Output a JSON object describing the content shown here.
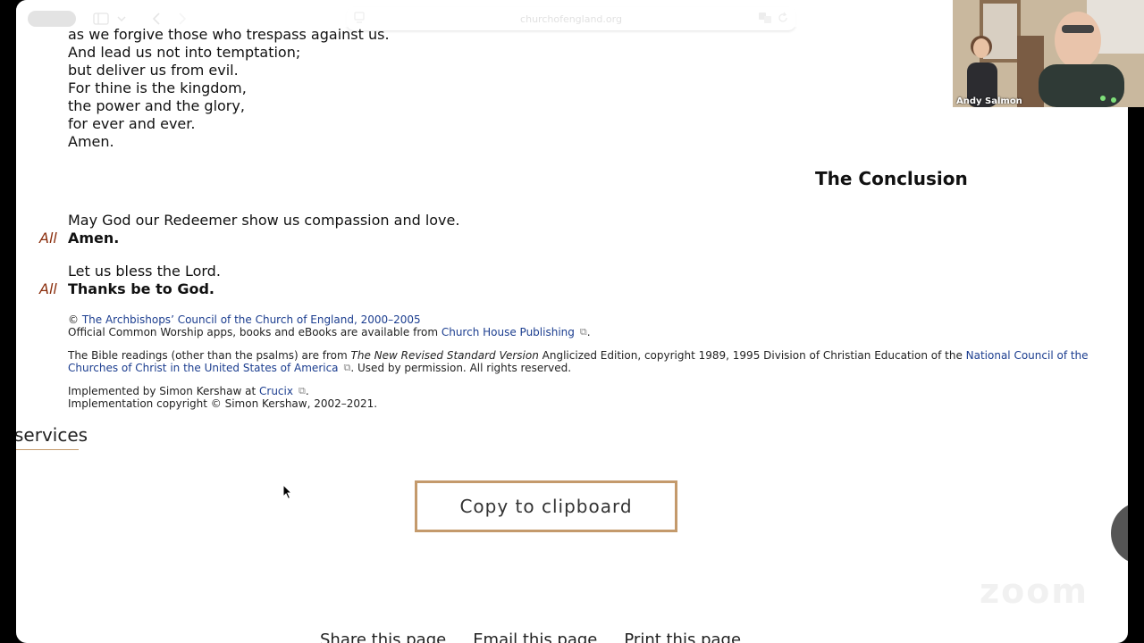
{
  "browser": {
    "url": "churchofengland.org"
  },
  "prayer_lines": [
    "as we forgive those who trespass against us.",
    "And lead us not into temptation;",
    "but deliver us from evil.",
    "For thine is the kingdom,",
    "the power and the glory,",
    "for ever and ever.",
    "Amen."
  ],
  "conclusion": {
    "heading": "The Conclusion",
    "leader1": "May God our Redeemer show us compassion and love.",
    "all_label": "All",
    "response1": "Amen.",
    "leader2": "Let us bless the Lord.",
    "response2": "Thanks be to God."
  },
  "copyright": {
    "c1_prefix": "© ",
    "c1_link": "The Archbishops’ Council of the Church of England, 2000–2005",
    "c2_prefix": "Official Common Worship apps, books and eBooks are available from ",
    "c2_link": "Church House Publishing",
    "c2_suffix": ".",
    "bible_prefix": "The Bible readings (other than the psalms) are from ",
    "bible_italic": "The New Revised Standard Version",
    "bible_mid": " Anglicized Edition, copyright 1989, 1995 Division of Christian Education of the ",
    "bible_link_a": "National Council of the",
    "bible_link_b": "Churches of Christ in the United States of America",
    "bible_suffix": ". Used by permission. All rights reserved.",
    "impl_prefix": "Implemented by Simon Kershaw at ",
    "impl_link": "Crucix",
    "impl_suffix": ".",
    "impl_copy": "Implementation copyright © Simon Kershaw, 2002–2021."
  },
  "services_label": "services",
  "copy_button": "Copy to clipboard",
  "footer": {
    "share": "Share this page",
    "email": "Email this page",
    "print": "Print this page"
  },
  "zoom_watermark": "zoom",
  "video": {
    "name": "Andy Salmon"
  },
  "colors": {
    "accent": "#c49a6c",
    "response_label": "#8b2f0e",
    "link": "#1b3d8f"
  }
}
